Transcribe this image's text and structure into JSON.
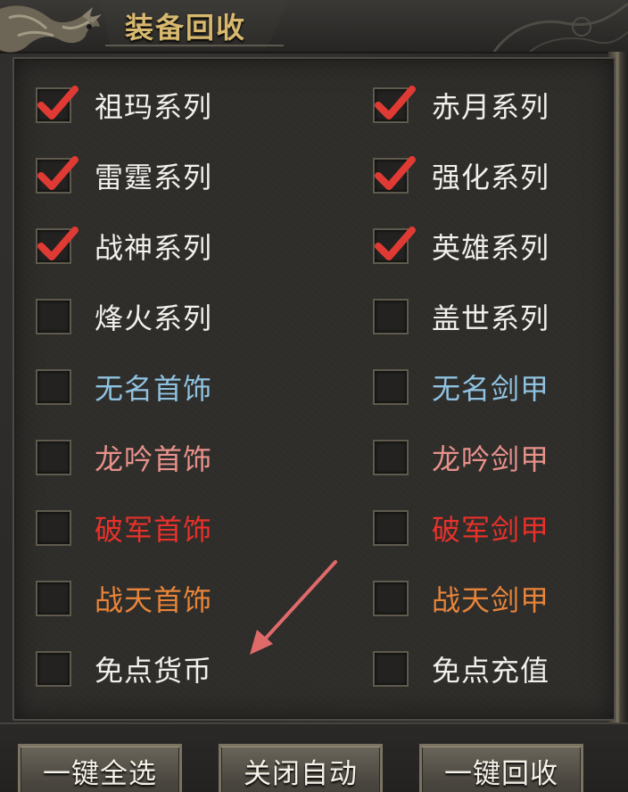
{
  "header": {
    "title": "装备回收"
  },
  "options": [
    {
      "label": "祖玛系列",
      "checked": true,
      "color": "white"
    },
    {
      "label": "赤月系列",
      "checked": true,
      "color": "white"
    },
    {
      "label": "雷霆系列",
      "checked": true,
      "color": "white"
    },
    {
      "label": "强化系列",
      "checked": true,
      "color": "white"
    },
    {
      "label": "战神系列",
      "checked": true,
      "color": "white"
    },
    {
      "label": "英雄系列",
      "checked": true,
      "color": "white"
    },
    {
      "label": "烽火系列",
      "checked": false,
      "color": "white"
    },
    {
      "label": "盖世系列",
      "checked": false,
      "color": "white"
    },
    {
      "label": "无名首饰",
      "checked": false,
      "color": "blue"
    },
    {
      "label": "无名剑甲",
      "checked": false,
      "color": "blue"
    },
    {
      "label": "龙吟首饰",
      "checked": false,
      "color": "pink"
    },
    {
      "label": "龙吟剑甲",
      "checked": false,
      "color": "pink"
    },
    {
      "label": "破军首饰",
      "checked": false,
      "color": "red"
    },
    {
      "label": "破军剑甲",
      "checked": false,
      "color": "red"
    },
    {
      "label": "战天首饰",
      "checked": false,
      "color": "orange"
    },
    {
      "label": "战天剑甲",
      "checked": false,
      "color": "orange"
    },
    {
      "label": "免点货币",
      "checked": false,
      "color": "white"
    },
    {
      "label": "免点充值",
      "checked": false,
      "color": "white"
    }
  ],
  "buttons": {
    "select_all": "一键全选",
    "close_auto": "关闭自动",
    "recycle_all": "一键回收"
  },
  "colors": {
    "white": "#f2f0ea",
    "blue": "#8fc2e0",
    "pink": "#e8918b",
    "red": "#e8312b",
    "orange": "#e8843a",
    "check": "#e03a34",
    "title": "#d7b86e",
    "annotation_arrow": "#e06a6a"
  }
}
